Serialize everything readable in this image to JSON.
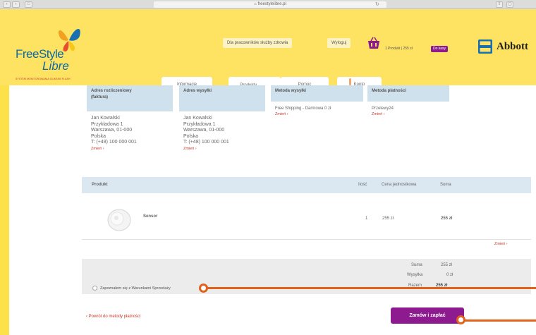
{
  "browser": {
    "url": "⌂ freestylelibre.pl",
    "reload_icon": "↻",
    "nav_back": "‹",
    "nav_forward": "›",
    "sidebar_toggle": "□"
  },
  "header": {
    "logo_freestyle": "FreeStyle",
    "logo_libre": "Libre",
    "logo_tagline": "SYSTEM MONITOROWANIA GLIKEMII FLASH",
    "health_pros_button": "Dla pracowników służby zdrowia",
    "logout_button": "Wyloguj",
    "basket_summary": "1 Produkt | 255 zł",
    "checkout_pill": "Do kasy",
    "brand": "Abbott",
    "colors": {
      "header_bg": "#fee262",
      "accent_purple": "#8e1a8f",
      "link_red": "#c0392b"
    }
  },
  "tabs": [
    {
      "label": "Informacje"
    },
    {
      "label": "Produkty"
    },
    {
      "label": "Pomoc"
    },
    {
      "label": "Konto"
    }
  ],
  "addresses": {
    "billing": {
      "title_line1": "Adres rozliczeniowy",
      "title_line2": "(faktura)",
      "line1": "Jan Kowalski",
      "line2": "Przykładowa 1",
      "line3": "Warszawa, 01-000",
      "line4": "Polska",
      "line5": "T: (+48) 100 000 001",
      "change": "Zmień ›"
    },
    "shipping": {
      "title": "Adres wysyłki",
      "line1": "Jan Kowalski",
      "line2": "Przykładowa 1",
      "line3": "Warszawa, 01-000",
      "line4": "Polska",
      "line5": "T: (+48) 100 000 001",
      "change": "Zmień ›"
    },
    "shipping_method": {
      "title": "Metoda wysyłki",
      "value": "Free Shipping - Darmowa 0 zł",
      "change": "Zmień ›"
    },
    "payment_method": {
      "title": "Metoda płatności",
      "value": "Przelewy24",
      "change": "Zmień ›"
    }
  },
  "table": {
    "headers": {
      "product": "Produkt",
      "qty": "Ilość",
      "unit_price": "Cena jednostkowa",
      "total": "Suma"
    },
    "row": {
      "name": "Sensor",
      "qty": "1",
      "unit_price": "255 zł",
      "total": "255 zł"
    },
    "change": "Zmień ›"
  },
  "summary": {
    "subtotal_label": "Suma",
    "subtotal_value": "255 zł",
    "shipping_label": "Wysyłka",
    "shipping_value": "0 zł",
    "total_label": "Razem",
    "total_value": "255 zł",
    "terms": "Zapoznałem się z Warunkami Sprzedaży"
  },
  "footer": {
    "back_link": "‹ Powrót do metody płatności",
    "order_button": "Zamów i zapłać"
  }
}
